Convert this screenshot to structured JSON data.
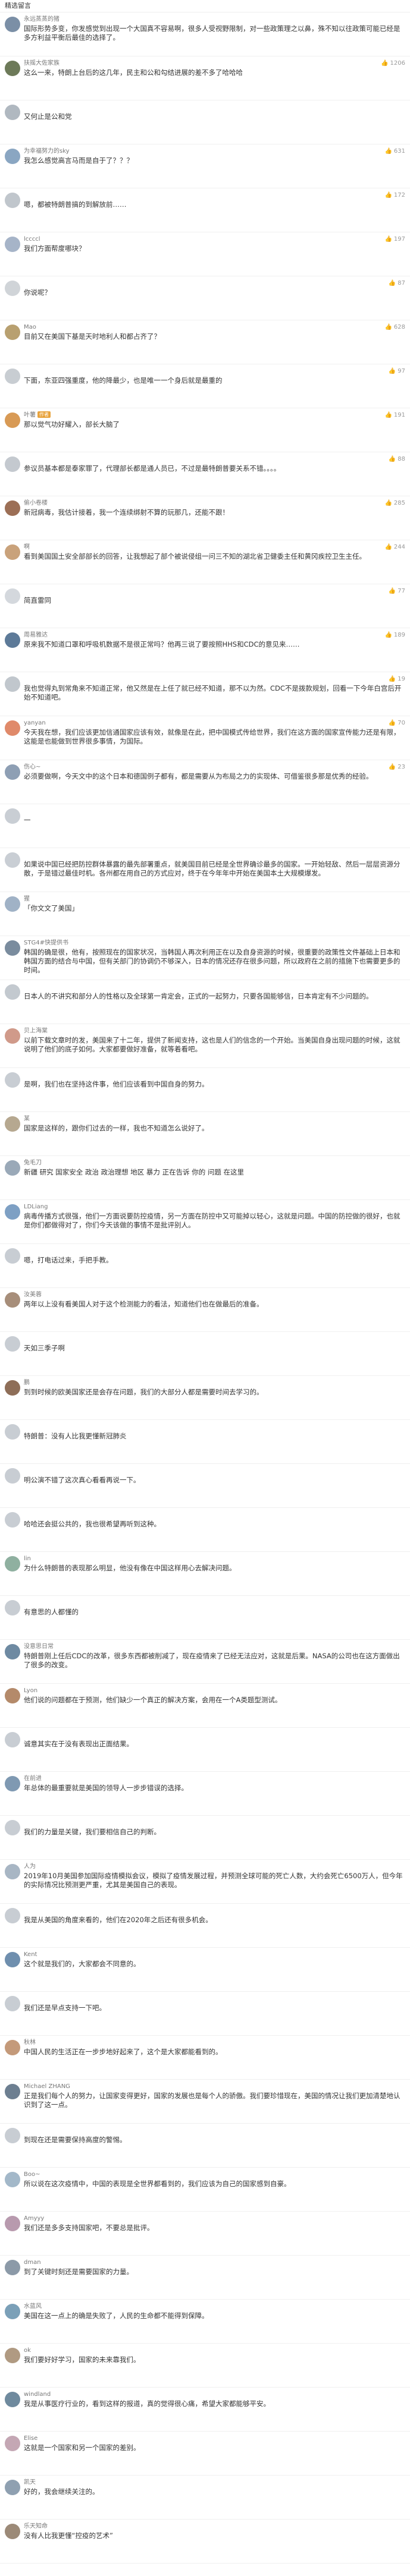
{
  "header": {
    "title": "精选留言"
  },
  "comments": [
    {
      "name": "永远蒸蒸的猪",
      "time": "",
      "likes": "",
      "text": "国际形势多变，你发感觉到出现一个大国真不容易啊，很多人受视野限制，对一些政策理之以鼻，殊不知以往政策可能已经是多方利益平衡后最佳的选择了。",
      "color": "#7b8fa6"
    },
    {
      "name": "扶摇大佐家族",
      "time": "",
      "likes": "1206",
      "text": "这么一来，特朗上台后的这几年，民主和公和勾结进展的差不多了哈哈哈",
      "color": "#6d7a59"
    },
    {
      "name": "",
      "time": "",
      "likes": "",
      "text": "又何止是公和党",
      "color": "#b0b8c0"
    },
    {
      "name": "为幸福努力的sky",
      "time": "",
      "likes": "631",
      "text": "我怎么感觉高言马而是自于了？？？",
      "color": "#8aa6c2"
    },
    {
      "name": "",
      "time": "",
      "likes": "172",
      "text": "嗯，都被特朗普搞的到解放前……",
      "color": "#c0c6cc"
    },
    {
      "name": "lccccl",
      "time": "",
      "likes": "197",
      "text": "我们方面帮度哪块？",
      "color": "#a6b4c8"
    },
    {
      "name": "",
      "time": "",
      "likes": "87",
      "text": "你说呢？",
      "color": "#d0d4d8"
    },
    {
      "name": "Mao",
      "time": "",
      "likes": "628",
      "text": "目前又在美国下基是天时地利人和都占齐了？",
      "color": "#b8a070"
    },
    {
      "name": "",
      "time": "",
      "likes": "97",
      "text": "下面，东亚四强重度，他的降最少，也是唯一一个身后就是最重的",
      "color": "#c8cdd2"
    },
    {
      "name": "叶薯",
      "bd": "作者",
      "time": "",
      "likes": "191",
      "text": "那以觉气功好耀入，部长大脑了",
      "color": "#d89a55"
    },
    {
      "name": "",
      "time": "",
      "likes": "88",
      "text": "参议员基本都是泰家罪了，代理部长都是通人员已，不过是最特朗普要关系不错。。。。",
      "color": "#c4c9cf"
    },
    {
      "name": "偷小卷楼",
      "time": "",
      "likes": "285",
      "text": "新冠病毒，我估计接着，我一个连续绑射不算的玩那几，还能不跟！",
      "color": "#9c6f56"
    },
    {
      "name": "啊",
      "time": "",
      "likes": "244",
      "text": "看到美国国土安全部部长的回答，让我想起了部个被说侵组一问三不知的湖北省卫健委主任和黄冈疾控卫生主任。",
      "color": "#c9a27b"
    },
    {
      "name": "",
      "time": "",
      "likes": "77",
      "text": "简直雷同",
      "color": "#d4d8dd"
    },
    {
      "name": "周易雅达",
      "time": "",
      "likes": "189",
      "text": "原来我不知道口罩和呼吸机数据不是很正常吗？他再三说了要按照HHS和CDC的意见来……",
      "color": "#5d7a98"
    },
    {
      "name": "",
      "time": "",
      "likes": "19",
      "text": "我也觉得丸到常角来不知道正常，他又然是在上任了就已经不知道，那不以为然。CDC不是拨款规划，回看一下今年白宫后开始不知道吧。",
      "color": "#c1c7cd"
    },
    {
      "name": "yanyan",
      "time": "",
      "likes": "70",
      "text": "今天我在想，我们应该更加信通国家应该有效，就像是在此，把中国模式传给世界，我们在这方面的国家宣传能力还是有限，这能是也能做到世界很多事情，为国际。",
      "color": "#e08a6a"
    },
    {
      "name": "伤心~",
      "time": "",
      "likes": "23",
      "text": "必须要做啊，今天文中的这个日本和德国例子都有，都是需要从为布局之力的实现体、可借鉴很多那是优秀的经验。",
      "color": "#8e9fb4"
    },
    {
      "name": "",
      "time": "",
      "likes": "",
      "text": "一",
      "color": "#c9ced4"
    },
    {
      "name": "",
      "time": "",
      "likes": "",
      "text": "如果说中国已经把防控群体暴露的最先部署重点，就美国目前已经是全世界确诊最多的国家。一开始轻敌、然后一层层资源分散，于是错过最佳时机。各州都在用自己的方式应对，终于在今年年中开始在美国本土大规模爆发。",
      "color": "#c9ced4"
    },
    {
      "name": "猩",
      "time": "",
      "likes": "",
      "text": "「你文文了美国」",
      "color": "#a0b2c6"
    },
    {
      "name": "STG4#快提供书",
      "time": "",
      "likes": "",
      "text": "韩国的确是很，他有，按照现在的国家状况，当韩国人再次利用正在以及自身资源的时候，很重要的政策性文件基础上日本和韩国方面的结合与中国，但有关部门的协调仍不够深入，日本的情况还存在很多问题，所以政府在之前的措施下也需要更多的时间。",
      "color": "#7a8c9e"
    },
    {
      "name": "",
      "time": "",
      "likes": "",
      "text": "日本人的不讲究和部分人的性格以及全球第一肯定会，正式的一起努力，只要各国能够信，日本肯定有不少问题的。",
      "color": "#c3c9cf"
    },
    {
      "name": "贝上海棠",
      "time": "",
      "likes": "",
      "text": "以前下载文章时的发，美国来了十二年，提供了新闻支持，这也是人们的信念的一个开始。当美国自身出现问题的时候，这就说明了他们的底子如何。大家都要做好准备，就等着看吧。",
      "color": "#d09a8a"
    },
    {
      "name": "",
      "time": "",
      "likes": "",
      "text": "是啊，我们也在坚持这件事，他们应该看到中国自身的努力。",
      "color": "#c8cdd3"
    },
    {
      "name": "某",
      "time": "",
      "likes": "",
      "text": "国家是这样的，跟你们过去的一样，我也不知道怎么说好了。",
      "color": "#b6a890"
    },
    {
      "name": "兔毛刀",
      "time": "",
      "likes": "",
      "text": "新疆 研究 国家安全 政治 政治理想 地区 暴力 正在告诉 你的 问题 在这里",
      "color": "#9aa9b8"
    },
    {
      "name": "LDLiang",
      "time": "",
      "likes": "",
      "text": "病毒传播方式很强，他们一方面说要防控疫情，另一方面在防控中又可能掉以轻心，这就是问题。中国的防控做的很好，也就是你们都做得对了，你们今天该做的事情不是批评别人。",
      "color": "#7ea0c4"
    },
    {
      "name": "",
      "time": "",
      "likes": "",
      "text": "嗯，打电话过来，手把手教。",
      "color": "#c8cdd3"
    },
    {
      "name": "汝美蓉",
      "time": "",
      "likes": "",
      "text": "两年以上没有看美国人对于这个检测能力的看法，知道他们也在做最后的准备。",
      "color": "#a78e7a"
    },
    {
      "name": "",
      "time": "",
      "likes": "",
      "text": "天如三季子啊",
      "color": "#c8cdd3"
    },
    {
      "name": "鹏",
      "time": "",
      "likes": "",
      "text": "到到时候的欧美国家还是会存在问题，我们的大部分人都是需要时间去学习的。",
      "color": "#8e6e58"
    },
    {
      "name": "",
      "time": "",
      "likes": "",
      "text": "特朗普：没有人比我更懂新冠肺炎",
      "color": "#c8cdd3"
    },
    {
      "name": "",
      "time": "",
      "likes": "",
      "text": "明公演不错了这次真心看看再说一下。",
      "color": "#c8cdd3"
    },
    {
      "name": "",
      "time": "",
      "likes": "",
      "text": "哈哈还会挺公共的，我也很希望再听到这种。",
      "color": "#c8cdd3"
    },
    {
      "name": "lin",
      "time": "",
      "likes": "",
      "text": "为什么特朗普的表现那么明显，他没有像在中国这样用心去解决问题。",
      "color": "#8fb0a0"
    },
    {
      "name": "",
      "time": "",
      "likes": "",
      "text": "有意思的人都懂的",
      "color": "#c8cdd3"
    },
    {
      "name": "没意思日常",
      "time": "",
      "likes": "",
      "text": "特朗普刚上任后CDC的改革，很多东西都被削减了，现在疫情来了已经无法应对，这就是后果。NASA的公司也在这方面做出了很多的改变。",
      "color": "#6e8aa2"
    },
    {
      "name": "Lyon",
      "time": "",
      "likes": "",
      "text": "他们说的问题都在于预测，他们缺少一个真正的解决方案，会用在一个A类题型测试。",
      "color": "#b48a6a"
    },
    {
      "name": "",
      "time": "",
      "likes": "",
      "text": "诚意其实在于没有表现出正面结果。",
      "color": "#c8cdd3"
    },
    {
      "name": "在前进",
      "time": "",
      "likes": "",
      "text": "年总体的最重要就是美国的领导人一步步错误的选择。",
      "color": "#7f99b2"
    },
    {
      "name": "",
      "time": "",
      "likes": "",
      "text": "我们的力量是关键，我们要相信自己的判断。",
      "color": "#c8cdd3"
    },
    {
      "name": "人为",
      "time": "",
      "likes": "",
      "text": "2019年10月美国参加国际疫情模拟会议，模拟了疫情发展过程，并预测全球可能的死亡人数，大约会死亡6500万人，但今年的实际情况比预测更严重，尤其是美国自己的表现。",
      "color": "#a8b6c4"
    },
    {
      "name": "",
      "time": "",
      "likes": "",
      "text": "我是从美国的角度来看的，他们在2020年之后还有很多机会。",
      "color": "#c8cdd3"
    },
    {
      "name": "Kent",
      "time": "",
      "likes": "",
      "text": "这个就是我们的，大家都会不同意的。",
      "color": "#6f8fae"
    },
    {
      "name": "",
      "time": "",
      "likes": "",
      "text": "我们还是早点支持一下吧。",
      "color": "#c8cdd3"
    },
    {
      "name": "秋林",
      "time": "",
      "likes": "",
      "text": "中国人民的生活正在一步步地好起来了，这个是大家都能看到的。",
      "color": "#c49a7a"
    },
    {
      "name": "Michael ZHANG",
      "time": "",
      "likes": "",
      "text": "正是我们每个人的努力，让国家变得更好，国家的发展也是每个人的骄傲。我们要珍惜现在，美国的情况让我们更加清楚地认识到了这一点。",
      "color": "#6d7f91"
    },
    {
      "name": "",
      "time": "",
      "likes": "",
      "text": "到现在还是需要保持高度的警惕。",
      "color": "#c8cdd3"
    },
    {
      "name": "Boo~",
      "time": "",
      "likes": "",
      "text": "所以说在这次疫情中，中国的表现是全世界都看到的，我们应该为自己的国家感到自豪。",
      "color": "#a3b8c9"
    },
    {
      "name": "Amyyy",
      "time": "",
      "likes": "",
      "text": "我们还是多多支持国家吧，不要总是批评。",
      "color": "#b89aae"
    },
    {
      "name": "dman",
      "time": "",
      "likes": "",
      "text": "到了关键时刻还是需要国家的力量。",
      "color": "#8c9aa8"
    },
    {
      "name": "水蓝风",
      "time": "",
      "likes": "",
      "text": "美国在这一点上的确是失败了，人民的生命都不能得到保障。",
      "color": "#7ba0b8"
    },
    {
      "name": "ok",
      "time": "",
      "likes": "",
      "text": "我们要好好学习，国家的未来靠我们。",
      "color": "#b09a82"
    },
    {
      "name": "windland",
      "time": "",
      "likes": "",
      "text": "我是从事医疗行业的，看到这样的报道，真的觉得很心痛，希望大家都能够平安。",
      "color": "#6f8a9e"
    },
    {
      "name": "Elise",
      "time": "",
      "likes": "",
      "text": "这就是一个国家和另一个国家的差别。",
      "color": "#c4a7b4"
    },
    {
      "name": "凯天",
      "time": "",
      "likes": "",
      "text": "好的，我会继续关注的。",
      "color": "#8fa0b1"
    },
    {
      "name": "乐天知命",
      "time": "",
      "likes": "",
      "text": "没有人比我更懂“控疫的艺术”",
      "color": "#9c8a78"
    }
  ]
}
